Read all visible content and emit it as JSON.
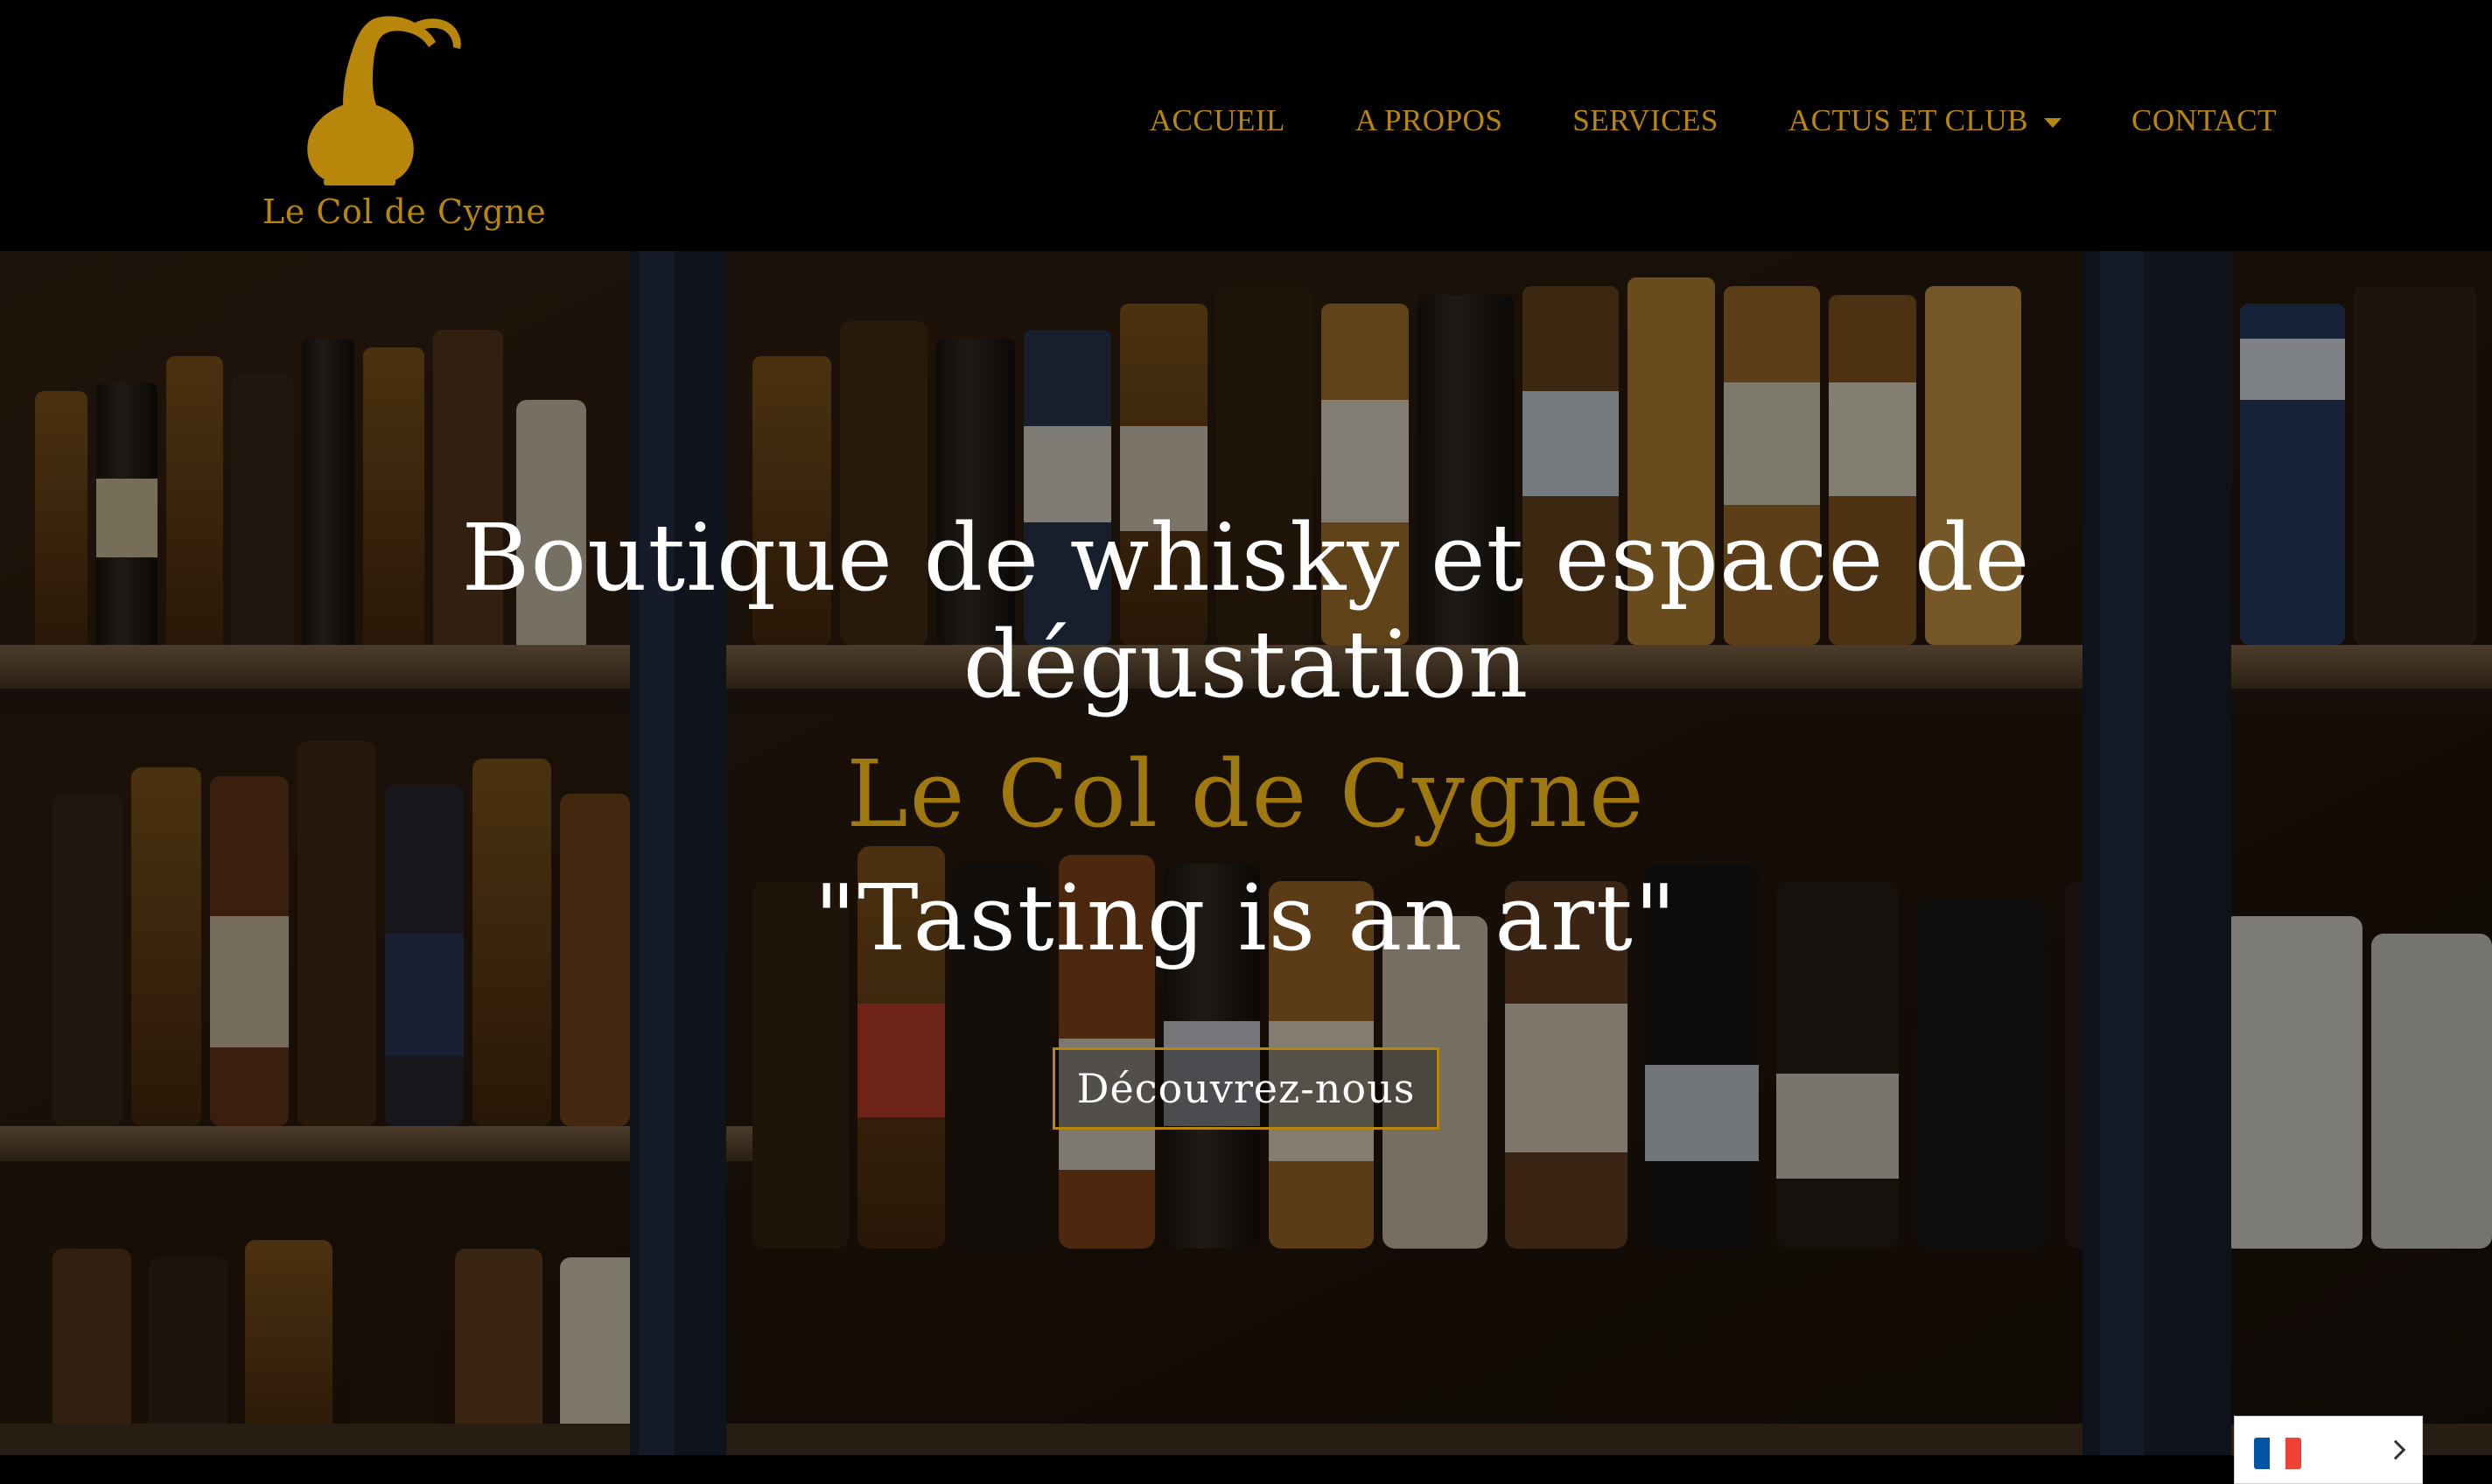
{
  "brand": {
    "name": "Le Col de Cygne",
    "logo_icon": "swan-neck-still-icon",
    "color": "#b8860b"
  },
  "nav": {
    "items": [
      {
        "label": "ACCUEIL"
      },
      {
        "label": "A PROPOS"
      },
      {
        "label": "SERVICES"
      },
      {
        "label": "ACTUS ET CLUB",
        "has_dropdown": true
      },
      {
        "label": "CONTACT"
      }
    ]
  },
  "hero": {
    "title": "Boutique de whisky et espace de dégustation",
    "brand": "Le Col de Cygne",
    "tagline": "\"Tasting is an art\"",
    "button_label": "Découvrez-nous",
    "background": "whisky-bottles-shelves-photo"
  },
  "language_switcher": {
    "flag": "france-flag-icon",
    "colors": [
      "#0055a4",
      "#ffffff",
      "#ef4135"
    ]
  },
  "colors": {
    "accent": "#b8860b",
    "background": "#000000",
    "text": "#ffffff"
  }
}
